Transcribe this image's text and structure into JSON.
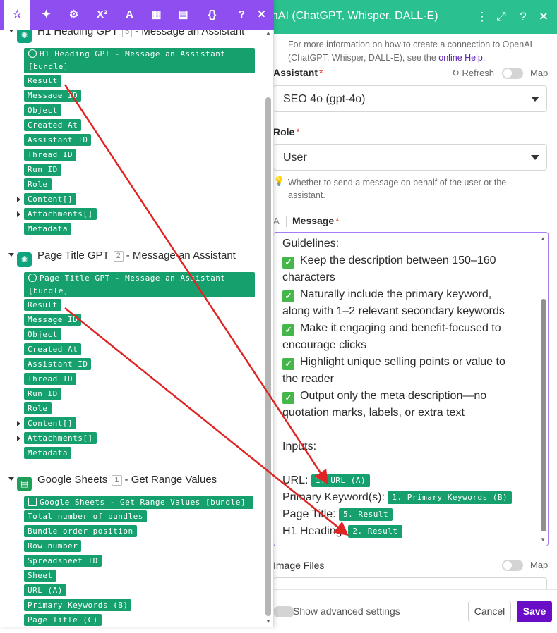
{
  "right_panel": {
    "title": "enAI (ChatGPT, Whisper, DALL-E)",
    "info_text_1": "For more information on how to create a connection to OpenAI (ChatGPT, Whisper, DALL-E), see the ",
    "info_link": "online Help",
    "info_text_2": ".",
    "assistant_label": "Assistant",
    "refresh_label": "Refresh",
    "map_label": "Map",
    "assistant_value": "SEO 4o (gpt-4o)",
    "role_label": "Role",
    "role_value": "User",
    "role_hint": "Whether to send a message on behalf of the user or the assistant.",
    "message_label": "Message",
    "message": {
      "guidelines": "Guidelines:",
      "items": [
        [
          "Keep the description between 150–160",
          "characters"
        ],
        [
          "Naturally include the primary keyword,",
          "along with 1–2 relevant secondary keywords"
        ],
        [
          "Make it engaging and benefit-focused to",
          "encourage clicks"
        ],
        [
          "Highlight unique selling points or value to",
          "the reader"
        ],
        [
          "Output only the meta description—no",
          "quotation marks, labels, or extra text"
        ]
      ],
      "inputs_label": "Inputs:",
      "url_label": "URL:",
      "url_pill": "1. URL (A)",
      "pk_label": "Primary Keyword(s):",
      "pk_pill": "1. Primary Keywords (B)",
      "pt_label": "Page Title:",
      "pt_pill": "5. Result",
      "h1_label": "H1 Heading:",
      "h1_pill": "2. Result"
    },
    "image_files_label": "Image Files",
    "image_map_label": "Map",
    "show_advanced": "Show advanced settings",
    "cancel": "Cancel",
    "save": "Save"
  },
  "toolbar": {
    "icons": [
      "star-icon",
      "sparkle-icon",
      "gear-icon",
      "superscript-icon",
      "text-icon",
      "calendar-icon",
      "table-icon",
      "braces-icon",
      "help-icon",
      "close-icon"
    ],
    "glyphs": [
      "☆",
      "✦",
      "⚙",
      "X²",
      "A",
      "▦",
      "▤",
      "{}",
      "?",
      "✕"
    ]
  },
  "modules": [
    {
      "title": "H1 Heading GPT",
      "badge": "5",
      "subtitle": "- Message an Assistant",
      "bundle": "H1 Heading GPT - Message an Assistant [bundle]",
      "items": [
        "Result",
        "Message ID",
        "Object",
        "Created At",
        "Assistant ID",
        "Thread ID",
        "Run ID",
        "Role",
        "Content[]",
        "Attachments[]",
        "Metadata"
      ]
    },
    {
      "title": "Page Title GPT",
      "badge": "2",
      "subtitle": "- Message an Assistant",
      "bundle": "Page Title GPT - Message an Assistant [bundle]",
      "items": [
        "Result",
        "Message ID",
        "Object",
        "Created At",
        "Assistant ID",
        "Thread ID",
        "Run ID",
        "Role",
        "Content[]",
        "Attachments[]",
        "Metadata"
      ]
    },
    {
      "title": "Google Sheets",
      "badge": "1",
      "subtitle": "- Get Range Values",
      "bundle": "Google Sheets - Get Range Values [bundle]",
      "items": [
        "Total number of bundles",
        "Bundle order position",
        "Row number",
        "Spreadsheet ID",
        "Sheet",
        "URL (A)",
        "Primary Keywords (B)",
        "Page Title (C)"
      ]
    }
  ],
  "colors": {
    "header_green": "#2bc08f",
    "toolbar_purple": "#8f4ef0",
    "tag_green": "#16a06e",
    "save_purple": "#6a0dc7",
    "arrow_red": "#e02424"
  }
}
